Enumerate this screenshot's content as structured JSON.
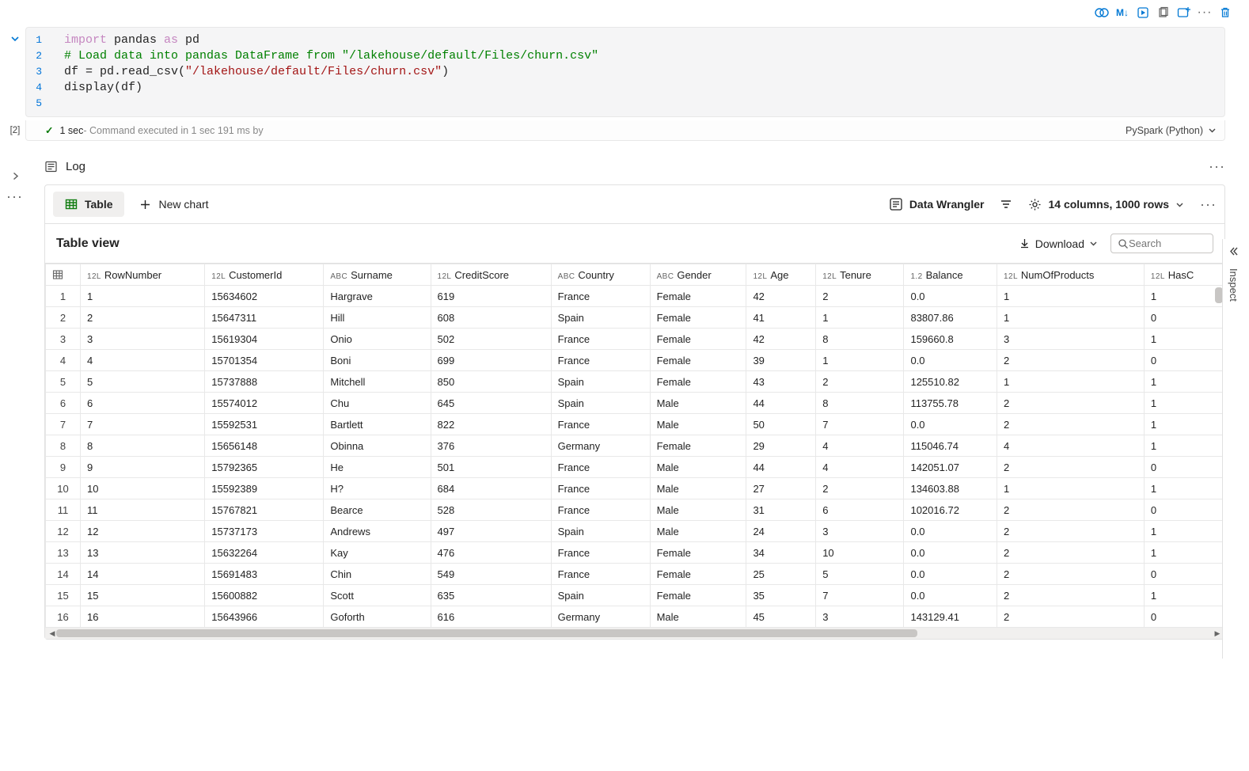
{
  "code": {
    "lines": [
      {
        "n": "1"
      },
      {
        "n": "2"
      },
      {
        "n": "3"
      },
      {
        "n": "4"
      },
      {
        "n": "5"
      }
    ],
    "l1_import": "import",
    "l1_pandas": " pandas ",
    "l1_as": "as",
    "l1_pd": " pd",
    "l2_comment": "# Load data into pandas DataFrame from \"/lakehouse/default/Files/churn.csv\"",
    "l3_pre": "df = pd.read_csv(",
    "l3_str": "\"/lakehouse/default/Files/churn.csv\"",
    "l3_post": ")",
    "l4": "display(df)"
  },
  "status": {
    "exec_num": "[2]",
    "time": "1 sec",
    "msg": " - Command executed in 1 sec 191 ms by",
    "lang": "PySpark (Python)"
  },
  "log_label": "Log",
  "result": {
    "table_btn": "Table",
    "newchart_btn": "New chart",
    "wrangler_btn": "Data Wrangler",
    "cols_rows": "14 columns, 1000 rows",
    "view_title": "Table view",
    "download": "Download",
    "search_placeholder": "Search"
  },
  "inspect": "Inspect",
  "columns": [
    {
      "type": "12L",
      "name": "RowNumber"
    },
    {
      "type": "12L",
      "name": "CustomerId"
    },
    {
      "type": "ABC",
      "name": "Surname"
    },
    {
      "type": "12L",
      "name": "CreditScore"
    },
    {
      "type": "ABC",
      "name": "Country"
    },
    {
      "type": "ABC",
      "name": "Gender"
    },
    {
      "type": "12L",
      "name": "Age"
    },
    {
      "type": "12L",
      "name": "Tenure"
    },
    {
      "type": "1.2",
      "name": "Balance"
    },
    {
      "type": "12L",
      "name": "NumOfProducts"
    },
    {
      "type": "12L",
      "name": "HasC"
    }
  ],
  "rows": [
    [
      "1",
      "1",
      "15634602",
      "Hargrave",
      "619",
      "France",
      "Female",
      "42",
      "2",
      "0.0",
      "1",
      "1"
    ],
    [
      "2",
      "2",
      "15647311",
      "Hill",
      "608",
      "Spain",
      "Female",
      "41",
      "1",
      "83807.86",
      "1",
      "0"
    ],
    [
      "3",
      "3",
      "15619304",
      "Onio",
      "502",
      "France",
      "Female",
      "42",
      "8",
      "159660.8",
      "3",
      "1"
    ],
    [
      "4",
      "4",
      "15701354",
      "Boni",
      "699",
      "France",
      "Female",
      "39",
      "1",
      "0.0",
      "2",
      "0"
    ],
    [
      "5",
      "5",
      "15737888",
      "Mitchell",
      "850",
      "Spain",
      "Female",
      "43",
      "2",
      "125510.82",
      "1",
      "1"
    ],
    [
      "6",
      "6",
      "15574012",
      "Chu",
      "645",
      "Spain",
      "Male",
      "44",
      "8",
      "113755.78",
      "2",
      "1"
    ],
    [
      "7",
      "7",
      "15592531",
      "Bartlett",
      "822",
      "France",
      "Male",
      "50",
      "7",
      "0.0",
      "2",
      "1"
    ],
    [
      "8",
      "8",
      "15656148",
      "Obinna",
      "376",
      "Germany",
      "Female",
      "29",
      "4",
      "115046.74",
      "4",
      "1"
    ],
    [
      "9",
      "9",
      "15792365",
      "He",
      "501",
      "France",
      "Male",
      "44",
      "4",
      "142051.07",
      "2",
      "0"
    ],
    [
      "10",
      "10",
      "15592389",
      "H?",
      "684",
      "France",
      "Male",
      "27",
      "2",
      "134603.88",
      "1",
      "1"
    ],
    [
      "11",
      "11",
      "15767821",
      "Bearce",
      "528",
      "France",
      "Male",
      "31",
      "6",
      "102016.72",
      "2",
      "0"
    ],
    [
      "12",
      "12",
      "15737173",
      "Andrews",
      "497",
      "Spain",
      "Male",
      "24",
      "3",
      "0.0",
      "2",
      "1"
    ],
    [
      "13",
      "13",
      "15632264",
      "Kay",
      "476",
      "France",
      "Female",
      "34",
      "10",
      "0.0",
      "2",
      "1"
    ],
    [
      "14",
      "14",
      "15691483",
      "Chin",
      "549",
      "France",
      "Female",
      "25",
      "5",
      "0.0",
      "2",
      "0"
    ],
    [
      "15",
      "15",
      "15600882",
      "Scott",
      "635",
      "Spain",
      "Female",
      "35",
      "7",
      "0.0",
      "2",
      "1"
    ],
    [
      "16",
      "16",
      "15643966",
      "Goforth",
      "616",
      "Germany",
      "Male",
      "45",
      "3",
      "143129.41",
      "2",
      "0"
    ]
  ]
}
